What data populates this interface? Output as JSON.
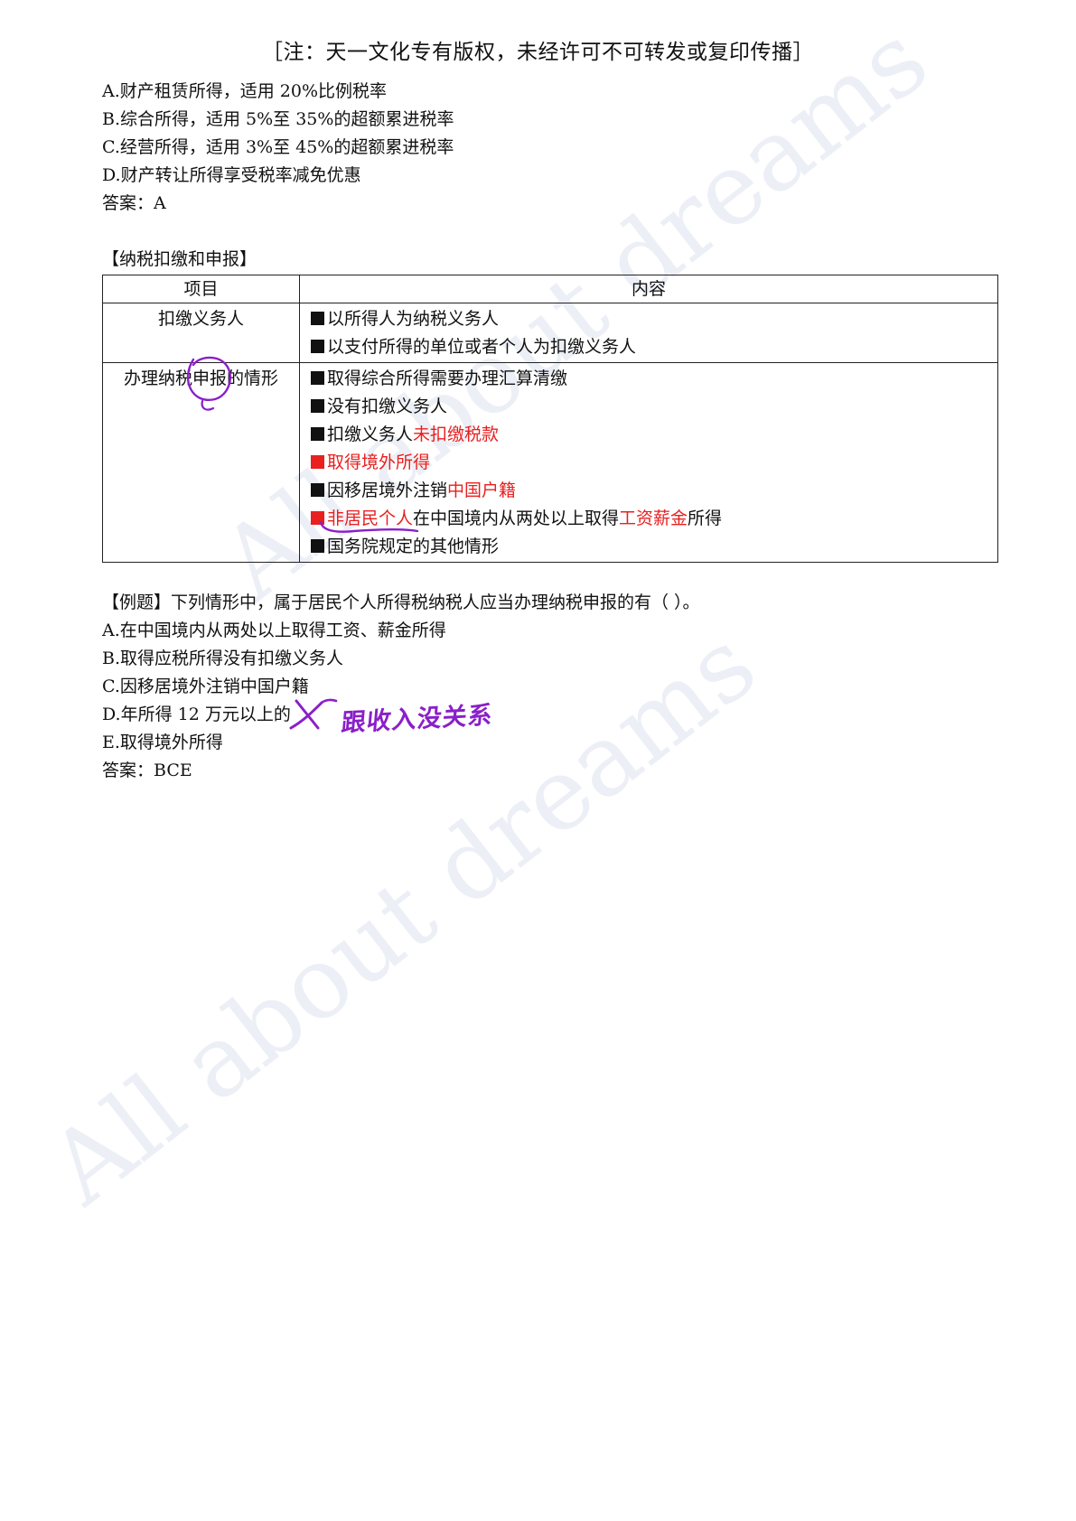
{
  "header": "［注：天一文化专有版权，未经许可不可转发或复印传播］",
  "options_top": [
    "A.财产租赁所得，适用 20%比例税率",
    "B.综合所得，适用 5%至 35%的超额累进税率",
    "C.经营所得，适用 3%至 45%的超额累进税率",
    "D.财产转让所得享受税率减免优惠"
  ],
  "answer_top": "答案：A",
  "section_title": "【纳税扣缴和申报】",
  "table": {
    "headers": [
      "项目",
      "内容"
    ],
    "row1_label": "扣缴义务人",
    "row1_items": [
      "以所得人为纳税义务人",
      "以支付所得的单位或者个人为扣缴义务人"
    ],
    "row2_label": "办理纳税申报的情形",
    "row2_items": [
      "取得综合所得需要办理汇算清缴",
      "没有扣缴义务人",
      "扣缴义务人",
      "未扣缴税款",
      "取得境外所得",
      "因移居境外注销",
      "中国户籍",
      "非居民个人",
      "在中国境内从两处以上取得",
      "工资薪金",
      "所得",
      "国务院规定的其他情形"
    ]
  },
  "example": {
    "question": "【例题】下列情形中，属于居民个人所得税纳税人应当办理纳税申报的有（  ）。",
    "options": [
      "A.在中国境内从两处以上取得工资、薪金所得",
      "B.取得应税所得没有扣缴义务人",
      "C.因移居境外注销中国户籍",
      "D.年所得 12 万元以上的",
      "E.取得境外所得"
    ],
    "answer": "答案：BCE"
  },
  "handwritten_note": "跟收入没关系",
  "watermark": "All about dreams",
  "colors": {
    "red": "#e8201f",
    "purple_ink": "#8a1fc9",
    "watermark": "#dde2ef"
  }
}
